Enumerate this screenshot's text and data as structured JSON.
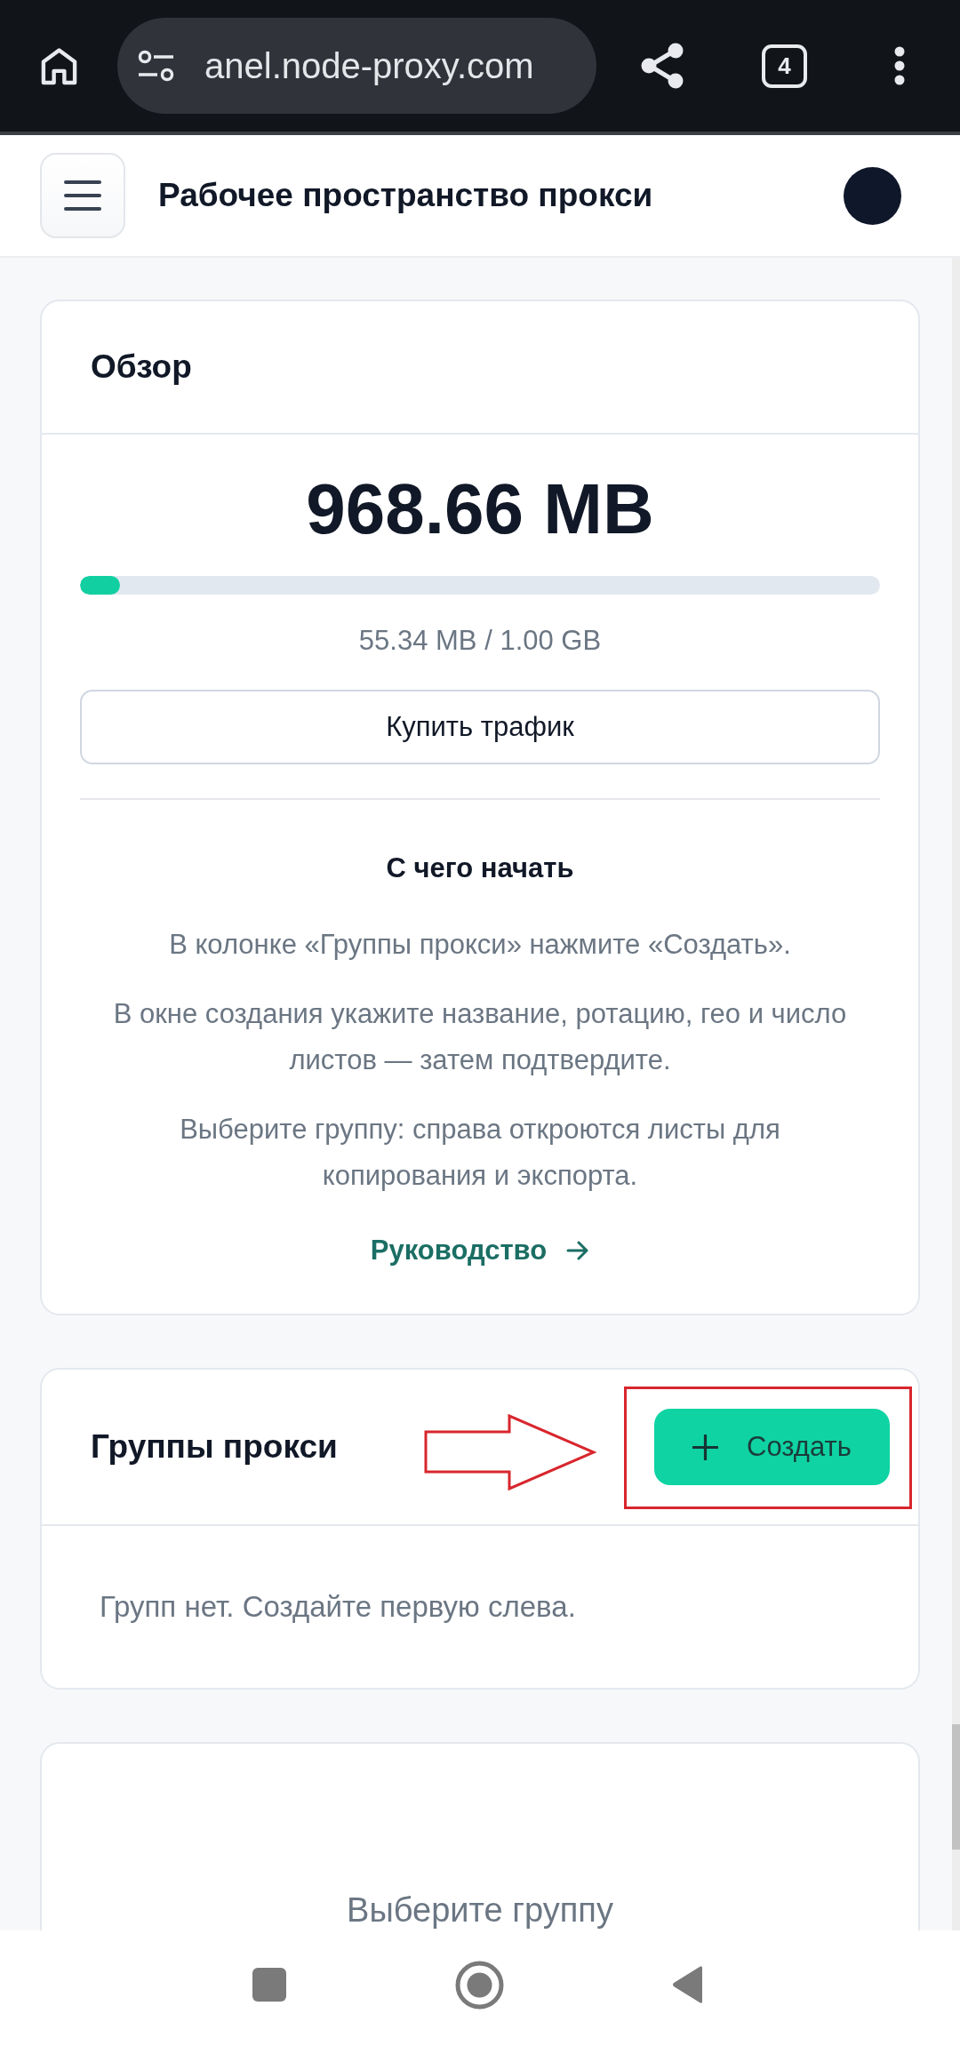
{
  "browser": {
    "url": "anel.node-proxy.com",
    "tab_count": "4"
  },
  "header": {
    "title": "Рабочее пространство прокси"
  },
  "overview": {
    "title": "Обзор",
    "remaining": "968.66 MB",
    "usage": {
      "level": 0.05,
      "reading": "55.34 MB / 1.00 GB"
    },
    "buy_button": "Купить трафик",
    "getting_started": {
      "title": "С чего начать",
      "steps": [
        "В колонке «Группы прокси» нажмите «Создать».",
        "В окне создания укажите название, ротацию, гео и число листов — затем подтвердите.",
        "Выберите группу: справа откроются листы для копирования и экспорта."
      ],
      "guide_link": "Руководство"
    }
  },
  "groups": {
    "title": "Группы прокси",
    "create_button": "Создать",
    "empty_text": "Групп нет. Создайте первую слева."
  },
  "details": {
    "prompt": "Выберите группу"
  }
}
